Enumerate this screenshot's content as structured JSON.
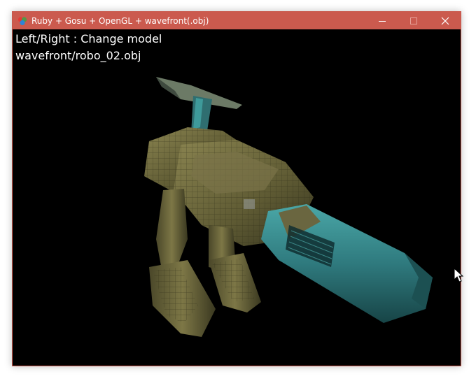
{
  "window": {
    "title": "Ruby + Gosu + OpenGL + wavefront(.obj)",
    "titlebar_color": "#cb5a4e",
    "controls": [
      "minimize-icon",
      "maximize-icon",
      "close-icon"
    ]
  },
  "hud": {
    "line1": "Left/Right : Change model",
    "line2": "wavefront/robo_02.obj"
  },
  "scene": {
    "background": "#000000",
    "model": "robo_02 rendered 3D mech with arm cannon",
    "palette": {
      "armor": "#6f6a3e",
      "armor_dark": "#3a3a22",
      "cannon": "#2b6f73",
      "cannon_light": "#3e9a9a"
    }
  }
}
